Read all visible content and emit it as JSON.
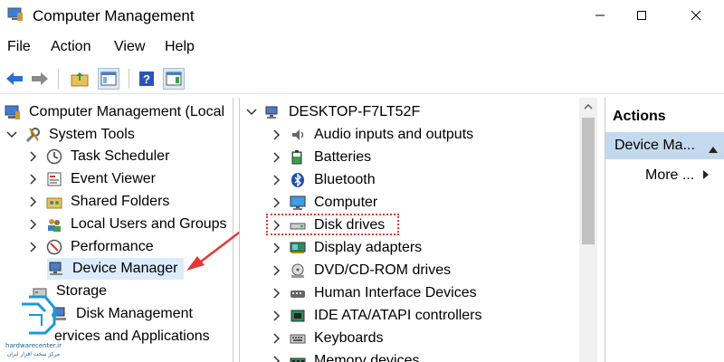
{
  "window": {
    "title": "Computer Management"
  },
  "menu": [
    "File",
    "Action",
    "View",
    "Help"
  ],
  "left_tree": [
    {
      "label": "Computer Management (Local",
      "chev": "",
      "icon": "computer-management-icon"
    },
    {
      "label": "System Tools",
      "chev": "down",
      "icon": "tools-icon"
    },
    {
      "label": "Task Scheduler",
      "chev": "right",
      "icon": "clock-icon"
    },
    {
      "label": "Event Viewer",
      "chev": "right",
      "icon": "event-viewer-icon"
    },
    {
      "label": "Shared Folders",
      "chev": "right",
      "icon": "shared-folder-icon"
    },
    {
      "label": "Local Users and Groups",
      "chev": "right",
      "icon": "users-icon"
    },
    {
      "label": "Performance",
      "chev": "right",
      "icon": "performance-icon"
    },
    {
      "label": "Device Manager",
      "chev": "",
      "icon": "device-manager-icon",
      "selected": true
    },
    {
      "label": "Storage",
      "chev": "down",
      "icon": "storage-icon"
    },
    {
      "label": "Disk Management",
      "chev": "",
      "icon": "disk-management-icon"
    },
    {
      "label": "ervices and Applications",
      "chev": "",
      "icon": ""
    }
  ],
  "device_tree": {
    "root": "DESKTOP-F7LT52F",
    "items": [
      {
        "label": "Audio inputs and outputs",
        "icon": "speaker-icon"
      },
      {
        "label": "Batteries",
        "icon": "battery-icon"
      },
      {
        "label": "Bluetooth",
        "icon": "bluetooth-icon"
      },
      {
        "label": "Computer",
        "icon": "monitor-icon"
      },
      {
        "label": "Disk drives",
        "icon": "disk-drive-icon",
        "highlight": true
      },
      {
        "label": "Display adapters",
        "icon": "display-adapter-icon"
      },
      {
        "label": "DVD/CD-ROM drives",
        "icon": "dvd-icon"
      },
      {
        "label": "Human Interface Devices",
        "icon": "hid-icon"
      },
      {
        "label": "IDE ATA/ATAPI controllers",
        "icon": "ide-controller-icon"
      },
      {
        "label": "Keyboards",
        "icon": "keyboard-icon"
      },
      {
        "label": "Memory devices",
        "icon": "memory-icon"
      }
    ]
  },
  "actions": {
    "header": "Actions",
    "selected": "Device Ma...",
    "more": "More ..."
  },
  "watermark": {
    "line1": "hardwarecenter.ir",
    "line2": "مرکز سخت افزار ایران"
  },
  "colors": {
    "selection": "#dcecfc",
    "actions_selected": "#c5d9ee",
    "annotation": "#e53935"
  }
}
